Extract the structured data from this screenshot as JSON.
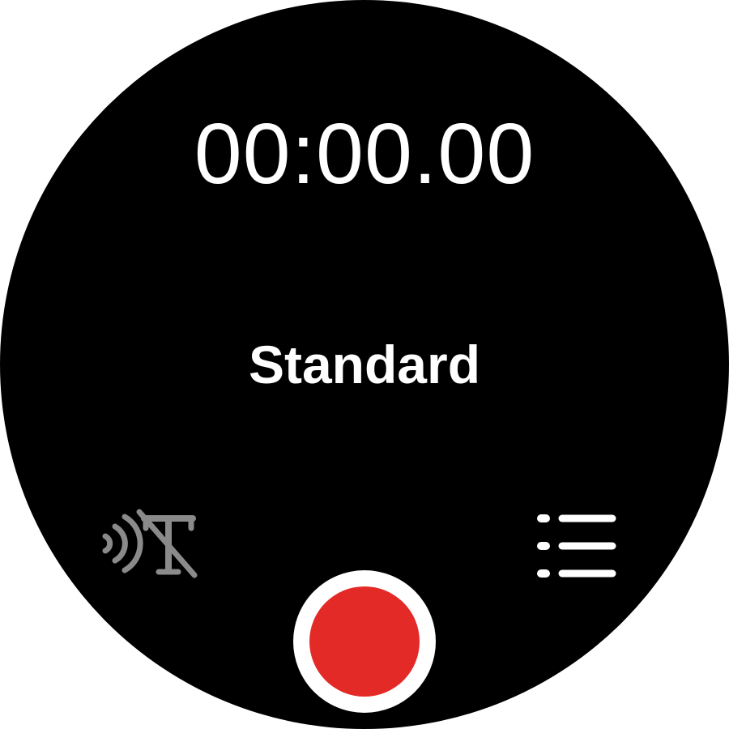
{
  "timer": {
    "value": "00:00.00"
  },
  "recording_mode": {
    "label": "Standard"
  },
  "controls": {
    "speech_to_text_icon": "speech-to-text-off-icon",
    "recordings_list_icon": "list-icon",
    "record_icon": "record-icon"
  },
  "colors": {
    "background": "#000000",
    "text": "#ffffff",
    "disabled_icon": "#8a8a8a",
    "record": "#e42a26",
    "record_ring": "#ffffff"
  }
}
